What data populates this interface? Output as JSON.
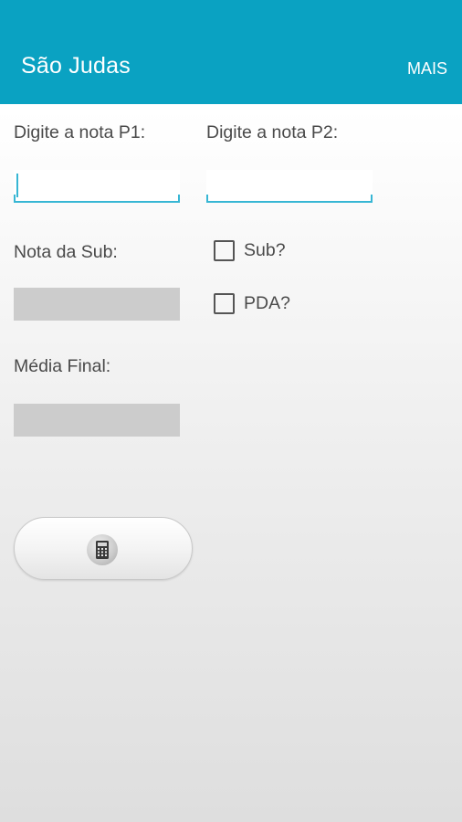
{
  "app_bar": {
    "title": "São Judas",
    "action_label": "MAIS",
    "color": "#0aa2c2"
  },
  "form": {
    "p1_label": "Digite a nota P1:",
    "p1_value": "",
    "p2_label": "Digite a nota P2:",
    "p2_value": "",
    "sub_label": "Nota da Sub:",
    "sub_value": "",
    "final_label": "Média Final:",
    "final_value": ""
  },
  "options": {
    "sub_checkbox_label": "Sub?",
    "sub_checked": false,
    "pda_checkbox_label": "PDA?",
    "pda_checked": false
  },
  "calculate_button": {
    "icon": "calculator-icon"
  }
}
